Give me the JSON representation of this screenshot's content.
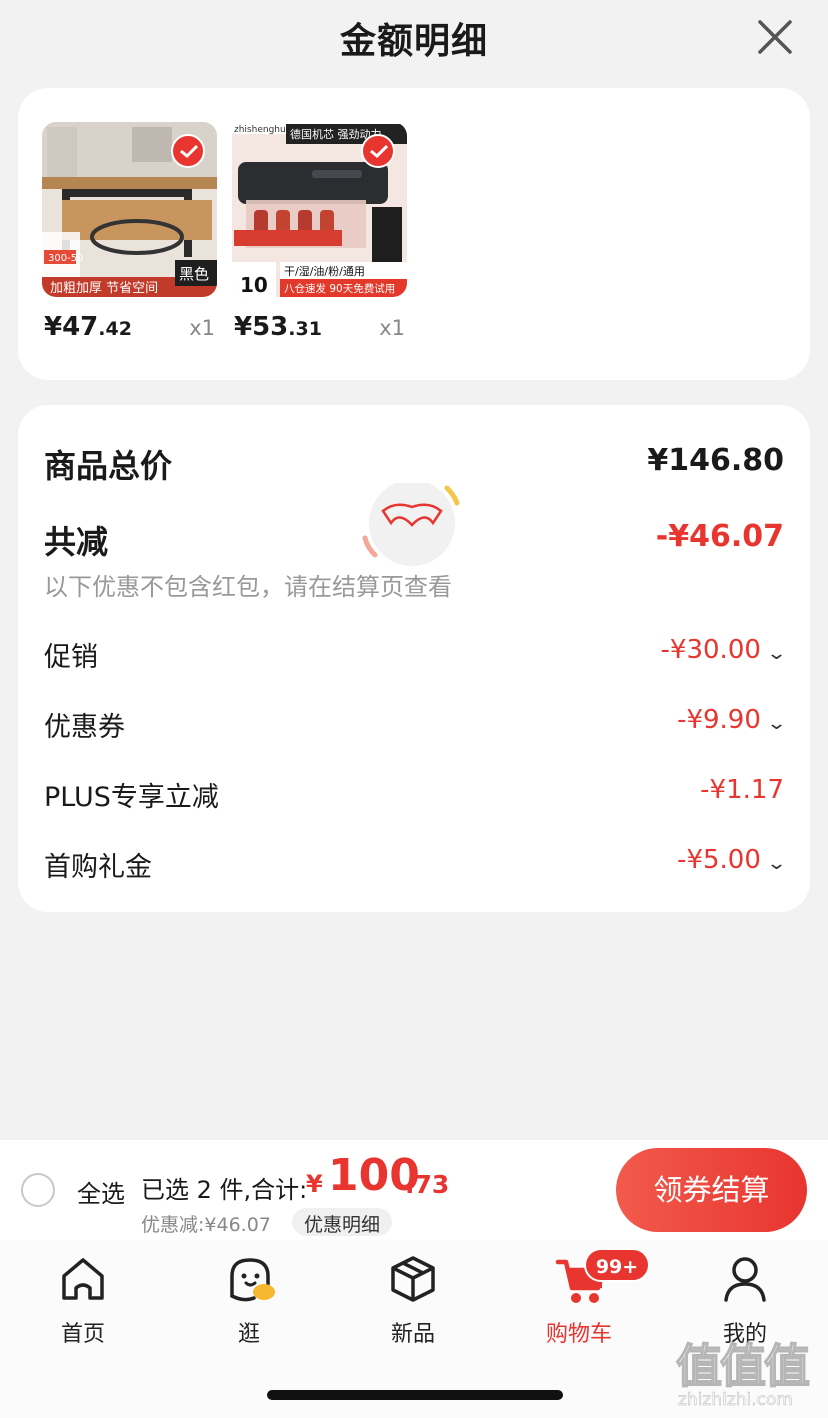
{
  "header": {
    "title": "金额明细"
  },
  "products": [
    {
      "price_int": "¥47",
      "price_dec": ".42",
      "qty": "x1",
      "img_caption": "加粗加厚 节省空间",
      "img_tag": "黑色",
      "img_promo": "300-50"
    },
    {
      "price_int": "¥53",
      "price_dec": ".31",
      "qty": "x1",
      "img_caption": "八仓速发 90天免费试用",
      "img_strip": "干/湿/油/粉/通用",
      "img_top": "德国机芯 强劲动力",
      "img_brand": "zhishenghuo",
      "img_num": "10"
    }
  ],
  "summary": {
    "total_label": "商品总价",
    "total_value": "¥146.80",
    "reduce_label": "共减",
    "reduce_value": "-¥46.07",
    "hint": "以下优惠不包含红包，请在结算页查看",
    "items": [
      {
        "label": "促销",
        "value": "-¥30.00",
        "expandable": true
      },
      {
        "label": "优惠券",
        "value": "-¥9.90",
        "expandable": true
      },
      {
        "label": "PLUS专享立减",
        "value": "-¥1.17",
        "expandable": false
      },
      {
        "label": "首购礼金",
        "value": "-¥5.00",
        "expandable": true
      }
    ]
  },
  "bottom_bar": {
    "select_all": "全选",
    "selected_text": "已选 2 件,合计:",
    "currency": "¥",
    "total_int": "100",
    "total_dec": ".73",
    "discount_text": "优惠减:¥46.07",
    "detail_label": "优惠明细",
    "checkout_label": "领券结算"
  },
  "tabbar": {
    "tabs": [
      {
        "label": "首页",
        "icon": "home-icon"
      },
      {
        "label": "逛",
        "icon": "browse-icon"
      },
      {
        "label": "新品",
        "icon": "new-products-icon"
      },
      {
        "label": "购物车",
        "icon": "cart-icon",
        "active": true
      },
      {
        "label": "我的",
        "icon": "profile-icon"
      }
    ],
    "cart_badge": "99+"
  },
  "watermark": {
    "logo": "值值值",
    "url": "zhizhizhi.com"
  },
  "colors": {
    "accent": "#e8352f",
    "background": "#f2f2f2"
  }
}
